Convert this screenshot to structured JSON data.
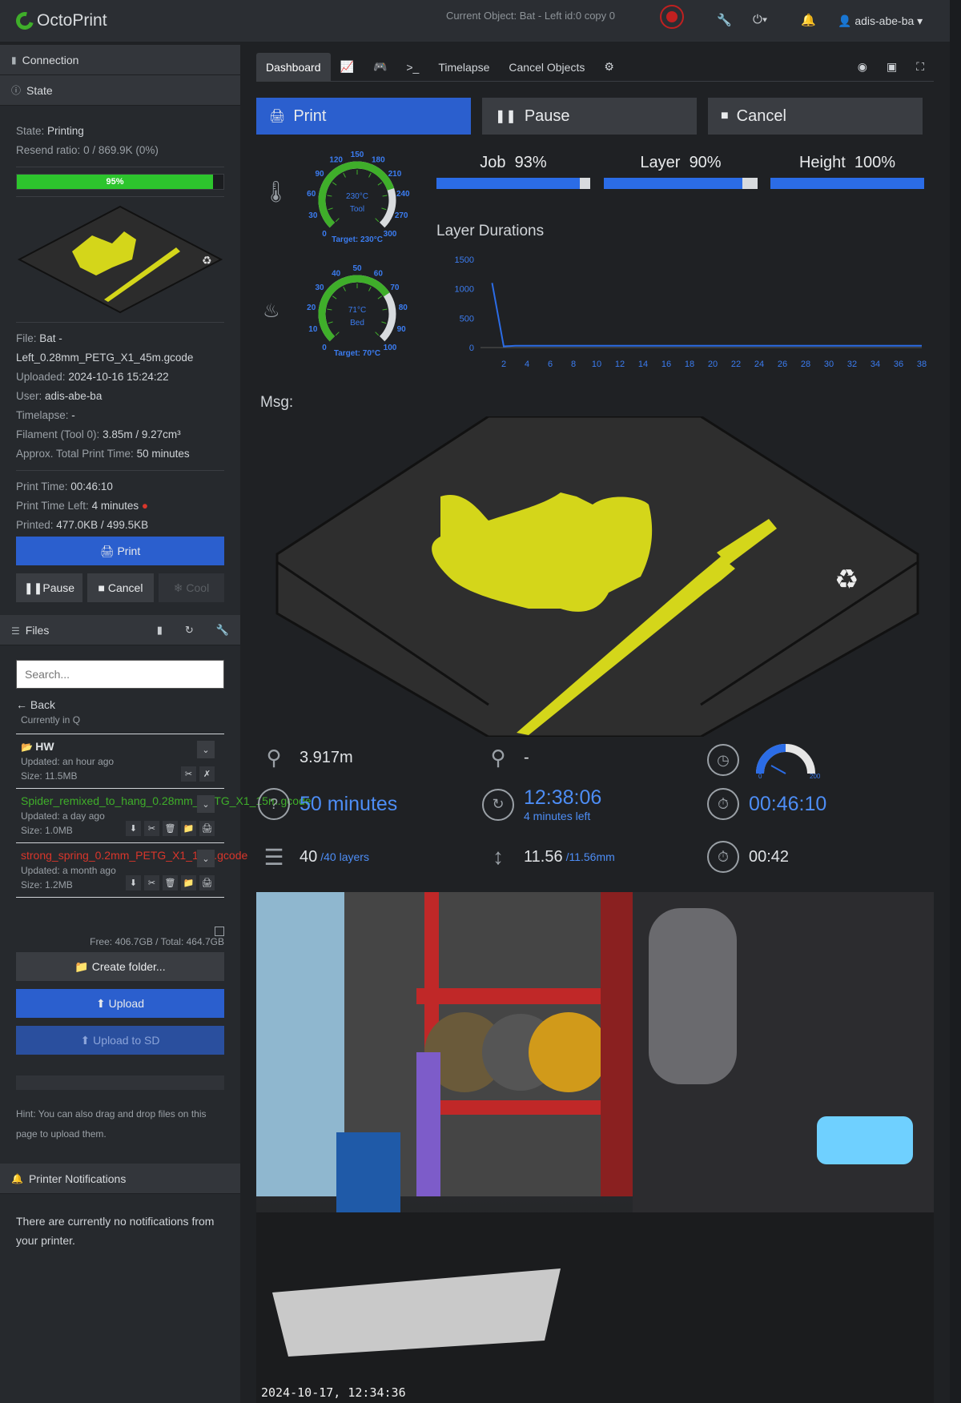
{
  "navbar": {
    "brand": "OctoPrint",
    "current_object": "Current Object: Bat - Left id:0 copy 0",
    "user": "adis-abe-ba"
  },
  "sidebar": {
    "connection": "Connection",
    "state_title": "State",
    "state_label": "State:",
    "state_value": "Printing",
    "resend_label": "Resend ratio:",
    "resend_value": "0 / 869.9K (0%)",
    "progress_text": "95%",
    "progress_fraction": 0.95,
    "file_label": "File:",
    "file_value": "Bat - Left_0.28mm_PETG_X1_45m.gcode",
    "uploaded_label": "Uploaded:",
    "uploaded_value": "2024-10-16 15:24:22",
    "user_label": "User:",
    "user_value": "adis-abe-ba",
    "timelapse_label": "Timelapse:",
    "timelapse_value": "-",
    "filament_label": "Filament (Tool 0):",
    "filament_value": "3.85m / 9.27cm³",
    "approx_label": "Approx. Total Print Time:",
    "approx_value": "50 minutes",
    "print_time_label": "Print Time:",
    "print_time_value": "00:46:10",
    "time_left_label": "Print Time Left:",
    "time_left_value": "4 minutes",
    "printed_label": "Printed:",
    "printed_value": "477.0KB / 499.5KB",
    "print_btn": "Print",
    "pause_btn": "Pause",
    "cancel_btn": "Cancel",
    "cool_btn": "Cool",
    "files_title": "Files",
    "search_placeholder": "Search...",
    "back": "Back",
    "currently_in": "Currently in Q",
    "files": [
      {
        "name": "HW",
        "updated": "Updated: an hour ago",
        "size": "Size: 11.5MB",
        "color": "#e0e3e6"
      },
      {
        "name": "Spider_remixed_to_hang_0.28mm_PETG_X1_15m.gcode",
        "updated": "Updated: a day ago",
        "size": "Size: 1.0MB",
        "color": "#3fae2a"
      },
      {
        "name": "strong_spring_0.2mm_PETG_X1_17m.gcode",
        "updated": "Updated: a month ago",
        "size": "Size: 1.2MB",
        "color": "#d9362b"
      }
    ],
    "free_space": "Free: 406.7GB / Total: 464.7GB",
    "create_folder": "Create folder...",
    "upload": "Upload",
    "upload_sd": "Upload to SD",
    "hint": "Hint: You can also drag and drop files on this page to upload them.",
    "notifications_title": "Printer Notifications",
    "notifications_text": "There are currently no notifications from your printer."
  },
  "tabs": {
    "dashboard": "Dashboard",
    "timelapse": "Timelapse",
    "cancel_objects": "Cancel Objects"
  },
  "controls": {
    "print": "Print",
    "pause": "Pause",
    "cancel": "Cancel"
  },
  "gauges": {
    "tool_value": "230°C",
    "tool_label": "Tool",
    "tool_target": "Target: 230°C",
    "tool_ticks": [
      "0",
      "30",
      "60",
      "90",
      "120",
      "150",
      "180",
      "210",
      "240",
      "270",
      "300"
    ],
    "bed_value": "71°C",
    "bed_label": "Bed",
    "bed_target": "Target: 70°C",
    "bed_ticks": [
      "0",
      "10",
      "20",
      "30",
      "40",
      "50",
      "60",
      "70",
      "80",
      "90",
      "100"
    ]
  },
  "progress_bars": {
    "job_label": "Job",
    "job_pct": "93%",
    "job_fraction": 0.93,
    "layer_label": "Layer",
    "layer_pct": "90%",
    "layer_fraction": 0.9,
    "height_label": "Height",
    "height_pct": "100%",
    "height_fraction": 1.0
  },
  "chart_data": {
    "type": "line",
    "title": "Layer Durations",
    "x": [
      1,
      2,
      3,
      4,
      5,
      6,
      7,
      8,
      9,
      10,
      11,
      12,
      13,
      14,
      15,
      16,
      17,
      18,
      19,
      20,
      21,
      22,
      23,
      24,
      25,
      26,
      27,
      28,
      29,
      30,
      31,
      32,
      33,
      34,
      35,
      36,
      37,
      38
    ],
    "y": [
      1100,
      20,
      30,
      30,
      30,
      30,
      30,
      30,
      30,
      30,
      30,
      30,
      30,
      30,
      30,
      30,
      30,
      30,
      30,
      30,
      30,
      30,
      30,
      30,
      30,
      30,
      30,
      30,
      30,
      30,
      30,
      30,
      30,
      30,
      30,
      30,
      30,
      30
    ],
    "xticks": [
      "2",
      "4",
      "6",
      "8",
      "10",
      "12",
      "14",
      "16",
      "18",
      "20",
      "22",
      "24",
      "26",
      "28",
      "30",
      "32",
      "34",
      "36",
      "38"
    ],
    "yticks": [
      "0",
      "500",
      "1000",
      "1500"
    ],
    "xlim": [
      0,
      38
    ],
    "ylim": [
      0,
      1500
    ],
    "color": "#2b6ce6"
  },
  "msg_label": "Msg:",
  "stats": {
    "filament_used": "3.917m",
    "filament_other": "-",
    "total_time": "50 minutes",
    "eta": "12:38:06",
    "eta_sub": "4 minutes left",
    "elapsed": "00:46:10",
    "layers": "40",
    "layers_total": "/40 layers",
    "height": "11.56",
    "height_total": "/11.56mm",
    "layer_time": "00:42",
    "speed_gauge_min": "0",
    "speed_gauge_max": "200"
  },
  "webcam": {
    "timestamp": "2024-10-17, 12:34:36"
  },
  "colors": {
    "accent": "#2b5fce",
    "progress": "#2dc52d",
    "print_yellow": "#d4d61a"
  }
}
